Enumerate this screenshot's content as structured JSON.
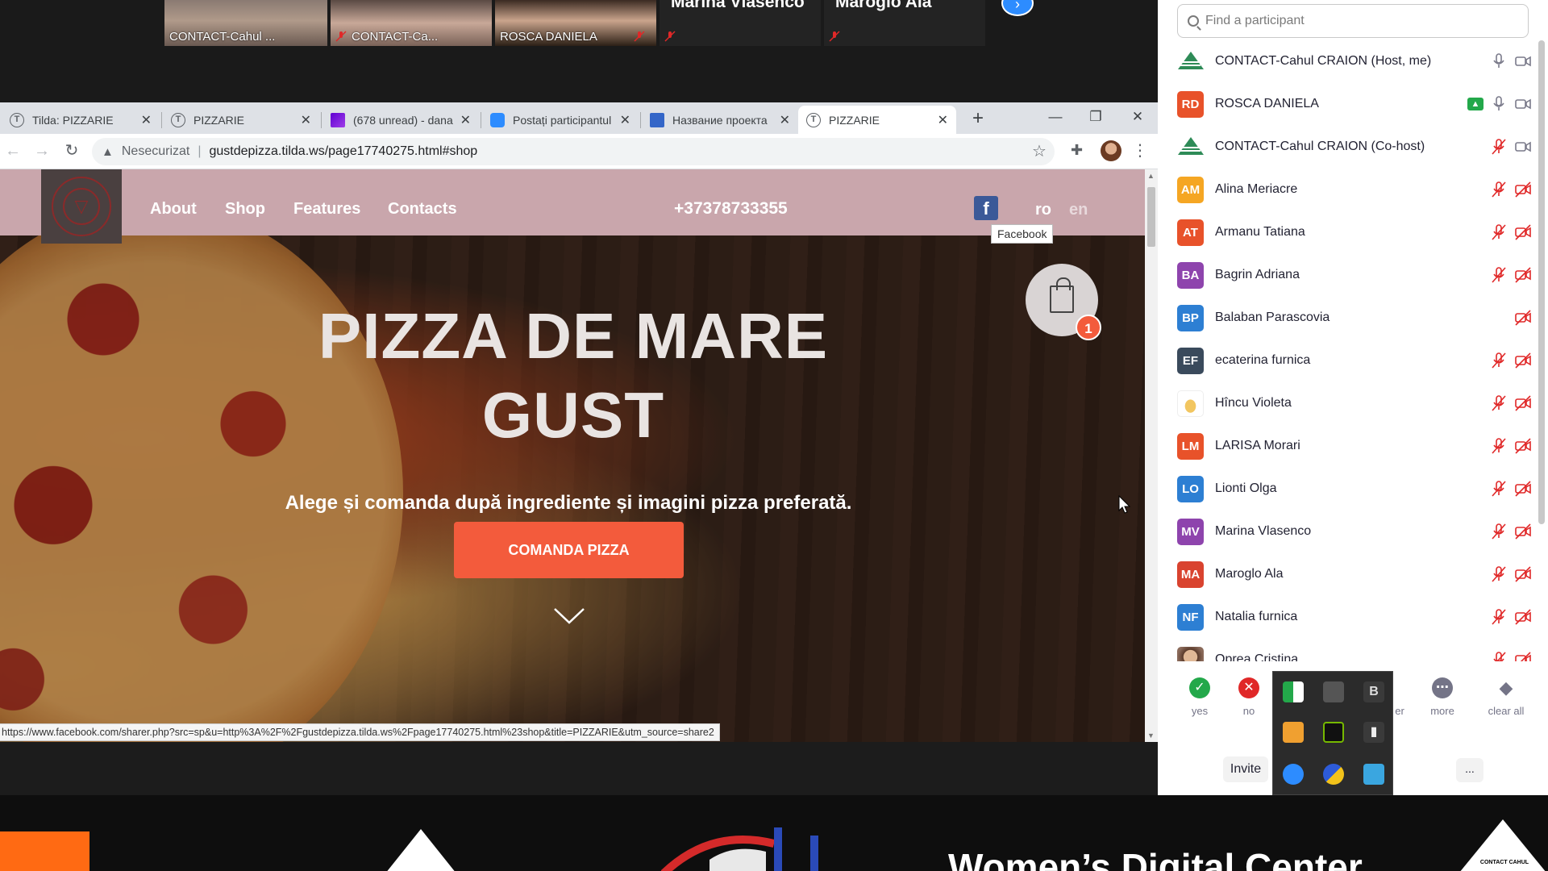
{
  "video_strip": {
    "tiles": [
      {
        "name": "CONTACT-Cahul ...",
        "muted": false,
        "active": true
      },
      {
        "name": "CONTACT-Ca...",
        "muted": true,
        "active": false
      },
      {
        "name": "ROSCA DANIELA",
        "muted": false,
        "active": false
      },
      {
        "name": "Marina Vlasenco",
        "muted": true,
        "active": false
      },
      {
        "name": "Maroglo Ala",
        "muted": true,
        "active": false
      }
    ]
  },
  "browser": {
    "tabs": [
      {
        "label": "Tilda: PIZZARIE",
        "icon": "tilda-icon",
        "active": false
      },
      {
        "label": "PIZZARIE",
        "icon": "tilda-icon",
        "active": false
      },
      {
        "label": "(678 unread) - dana.",
        "icon": "yahoo-mail-icon",
        "active": false
      },
      {
        "label": "Postați participantul",
        "icon": "zoom-icon",
        "active": false
      },
      {
        "label": "Название проекта",
        "icon": "project-icon",
        "active": false
      },
      {
        "label": "PIZZARIE",
        "icon": "tilda-icon",
        "active": true
      }
    ],
    "security_label": "Nesecurizat",
    "url": "gustdepizza.tilda.ws/page17740275.html#shop",
    "status_url": "https://www.facebook.com/sharer.php?src=sp&u=http%3A%2F%2Fgustdepizza.tilda.ws%2Fpage17740275.html%23shop&title=PIZZARIE&utm_source=share2"
  },
  "site": {
    "nav": [
      "About",
      "Shop",
      "Features",
      "Contacts"
    ],
    "phone": "+37378733355",
    "facebook_tooltip": "Facebook",
    "lang_ro": "ro",
    "lang_en": "en",
    "hero_title_line1": "PIZZA DE MARE",
    "hero_title_line2": "GUST",
    "hero_subtitle": "Alege și comanda după ingrediente și imagini pizza preferată.",
    "order_button": "COMANDA PIZZA",
    "cart_count": "1"
  },
  "participants": {
    "search_placeholder": "Find a participant",
    "list": [
      {
        "initials": "",
        "avatar": "contact-logo",
        "name": "CONTACT-Cahul CRAION (Host, me)",
        "mic": "on",
        "video": "on",
        "sharing": false
      },
      {
        "initials": "RD",
        "avatar": "#e8522a",
        "name": "ROSCA DANIELA",
        "mic": "on",
        "video": "on",
        "sharing": true
      },
      {
        "initials": "",
        "avatar": "contact-logo",
        "name": "CONTACT-Cahul CRAION (Co-host)",
        "mic": "off",
        "video": "on",
        "sharing": false
      },
      {
        "initials": "AM",
        "avatar": "#f5a623",
        "name": "Alina Meriacre",
        "mic": "off",
        "video": "off",
        "sharing": false
      },
      {
        "initials": "AT",
        "avatar": "#e8522a",
        "name": "Armanu Tatiana",
        "mic": "off",
        "video": "off",
        "sharing": false
      },
      {
        "initials": "BA",
        "avatar": "#8e44ad",
        "name": "Bagrin Adriana",
        "mic": "off",
        "video": "off",
        "sharing": false
      },
      {
        "initials": "BP",
        "avatar": "#2d7fd3",
        "name": "Balaban Parascovia",
        "mic": "none",
        "video": "off",
        "sharing": false
      },
      {
        "initials": "EF",
        "avatar": "#3a4a5c",
        "name": "ecaterina furnica",
        "mic": "off",
        "video": "off",
        "sharing": false
      },
      {
        "initials": "",
        "avatar": "house-logo",
        "name": "Hîncu Violeta",
        "mic": "off",
        "video": "off",
        "sharing": false
      },
      {
        "initials": "LM",
        "avatar": "#e8522a",
        "name": "LARISA Morari",
        "mic": "off",
        "video": "off",
        "sharing": false
      },
      {
        "initials": "LO",
        "avatar": "#2d7fd3",
        "name": "Lionti Olga",
        "mic": "off",
        "video": "off",
        "sharing": false
      },
      {
        "initials": "MV",
        "avatar": "#8e44ad",
        "name": "Marina Vlasenco",
        "mic": "off",
        "video": "off",
        "sharing": false
      },
      {
        "initials": "MA",
        "avatar": "#d9432f",
        "name": "Maroglo Ala",
        "mic": "off",
        "video": "off",
        "sharing": false
      },
      {
        "initials": "NF",
        "avatar": "#2d7fd3",
        "name": "Natalia furnica",
        "mic": "off",
        "video": "off",
        "sharing": false
      },
      {
        "initials": "",
        "avatar": "photo",
        "name": "Oprea Cristina",
        "mic": "off",
        "video": "off",
        "sharing": false
      }
    ],
    "reactions": {
      "yes": "yes",
      "no": "no",
      "partial": "er",
      "more": "more",
      "clear": "clear all"
    },
    "invite": "Invite",
    "more_dots": "..."
  },
  "banner": {
    "text": "Women’s Digital Center",
    "contact_logo_text": "CONTACT CAHUL"
  },
  "colors": {
    "accent": "#f35b3c",
    "header_bg": "#c9a6ac",
    "zoom_blue": "#2d8cff",
    "muted_red": "#e02828"
  }
}
